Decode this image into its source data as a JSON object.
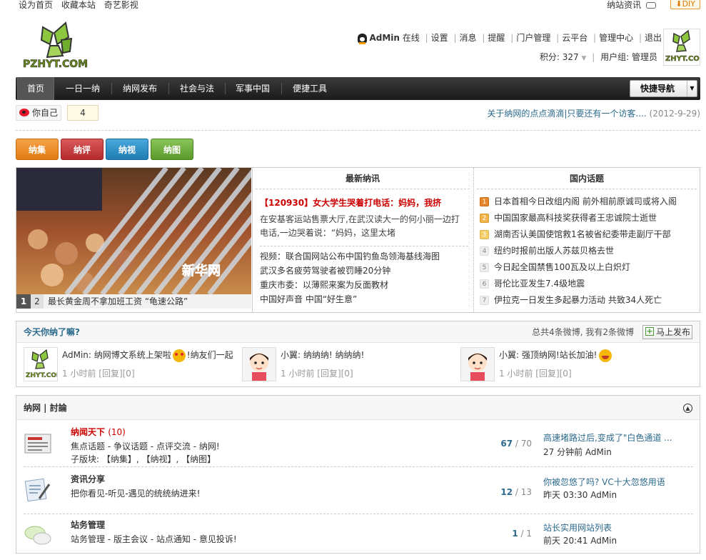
{
  "topbar": {
    "links": [
      "设为首页",
      "收藏本站",
      "奇艺影视"
    ],
    "right_link": "纳站资讯",
    "diy_label": "DIY"
  },
  "logo": {
    "text": "PZHYT.COM"
  },
  "user": {
    "name": "AdMin",
    "status": "在线",
    "links": [
      "设置",
      "消息",
      "提醒",
      "门户管理",
      "云平台",
      "管理中心",
      "退出"
    ],
    "points_label": "积分: 327",
    "group_label": "用户组: 管理员"
  },
  "nav": {
    "items": [
      "首页",
      "一日一纳",
      "纳网发布",
      "社会与法",
      "军事中国",
      "便捷工具"
    ],
    "quick_nav": "快捷导航"
  },
  "follow": {
    "label": "你自己",
    "count": "4"
  },
  "notice": {
    "text": "关于纳网的点点滴滴|只要还有一个访客....",
    "date": "(2012-9-29)"
  },
  "color_tabs": [
    {
      "label": "纳集",
      "color": "#f08a1c"
    },
    {
      "label": "纳评",
      "color": "#c8393b"
    },
    {
      "label": "纳视",
      "color": "#2a8fc8"
    },
    {
      "label": "纳图",
      "color": "#6aaa3a"
    }
  ],
  "slideshow": {
    "watermark": "新华网",
    "current": "1",
    "next_index": "2",
    "caption": "最长黄金周不拿加班工资 “龟速公路”"
  },
  "latest_news": {
    "title": "最新纳讯",
    "headline": "【120930】女大学生哭着打电话：妈妈，我挤",
    "summary": "在安基客运站售票大厅,在武汉读大一的何小丽一边打电话,一边哭着说：“妈妈，这里太堵",
    "items": [
      "视频：联合国网站公布中国钓鱼岛领海基线海图",
      "武汉多名疲劳驾驶者被罚睡20分钟",
      "重庆市委：以薄熙来案为反面教材",
      "中国好声音 中国“好生意”"
    ]
  },
  "hot_topics": {
    "title": "国内话题",
    "items": [
      {
        "rank": "1",
        "text": "日本首相今日改组内阁 前外相前原诚司或将入阁"
      },
      {
        "rank": "2",
        "text": "中国国家最高科技奖获得者王忠诚院士逝世"
      },
      {
        "rank": "3",
        "text": "湖南否认美国使馆救1名被省纪委带走副厅干部"
      },
      {
        "rank": "4",
        "text": "纽约时报前出版人苏兹贝格去世"
      },
      {
        "rank": "5",
        "text": "今日起全国禁售100瓦及以上白炽灯"
      },
      {
        "rank": "6",
        "text": "哥伦比亚发生7.4级地震"
      },
      {
        "rank": "7",
        "text": "伊拉克一日发生多起暴力活动 共致34人死亡"
      }
    ]
  },
  "weibo": {
    "question": "今天你纳了嘛?",
    "stats": "总共4条微博, 我有2条微博",
    "publish": "马上发布",
    "posts": [
      {
        "author": "AdMin:",
        "text_a": "纳网博文系统上架啦",
        "text_b": "!纳友们一起",
        "time": "1 小时前 [回复][0]"
      },
      {
        "author": "小翼:",
        "text_a": "纳纳纳! 纳纳纳!",
        "text_b": "",
        "time": "1 小时前 [回复][0]"
      },
      {
        "author": "小翼:",
        "text_a": "强顶纳网!站长加油!",
        "text_b": "",
        "time": "1 小时前 [回复][0]"
      }
    ]
  },
  "forum": {
    "title": "纳网 | 討論",
    "rows": [
      {
        "name": "纳闻天下",
        "count": "(10)",
        "desc": "焦点话题 - 争议话题 - 点评交流 - 纳网!",
        "sub": "子版块: 【纳集】, 【纳视】, 【纳图】",
        "threads": "67",
        "posts": "70",
        "last_title": "高速堵路过后,变成了\"白色通道 ...",
        "last_meta": "27 分钟前 AdMin"
      },
      {
        "name": "资讯分享",
        "count": "",
        "desc": "把你看见-听见-遇见的统统纳进来!",
        "sub": "",
        "threads": "12",
        "posts": "13",
        "last_title": "你被忽悠了吗? VC十大忽悠用语",
        "last_meta": "昨天 03:30 AdMin"
      },
      {
        "name": "站务管理",
        "count": "",
        "desc": "站务管理 - 版主会议 - 站点通知 - 意见投诉!",
        "sub": "",
        "threads": "1",
        "posts": "1",
        "last_title": "站长实用网站列表",
        "last_meta": "前天 20:41 AdMin"
      }
    ]
  }
}
